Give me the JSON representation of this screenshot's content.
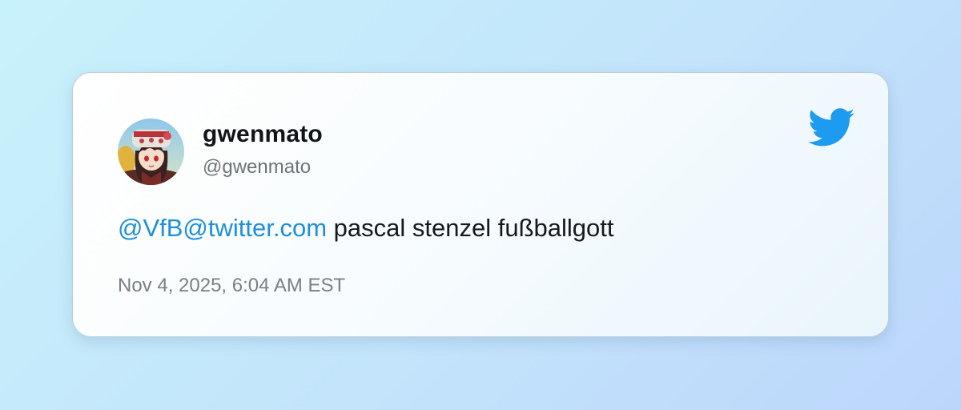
{
  "tweet": {
    "display_name": "gwenmato",
    "handle": "@gwenmato",
    "mention": "@VfB@twitter.com",
    "text": " pascal stenzel fußballgott",
    "timestamp": "Nov 4, 2025, 6:04 AM EST"
  },
  "icons": {
    "brand": "twitter-bird-icon",
    "avatar": "user-avatar"
  },
  "colors": {
    "twitter_blue": "#1d9bf0",
    "mention_blue": "#1d8fdc"
  }
}
